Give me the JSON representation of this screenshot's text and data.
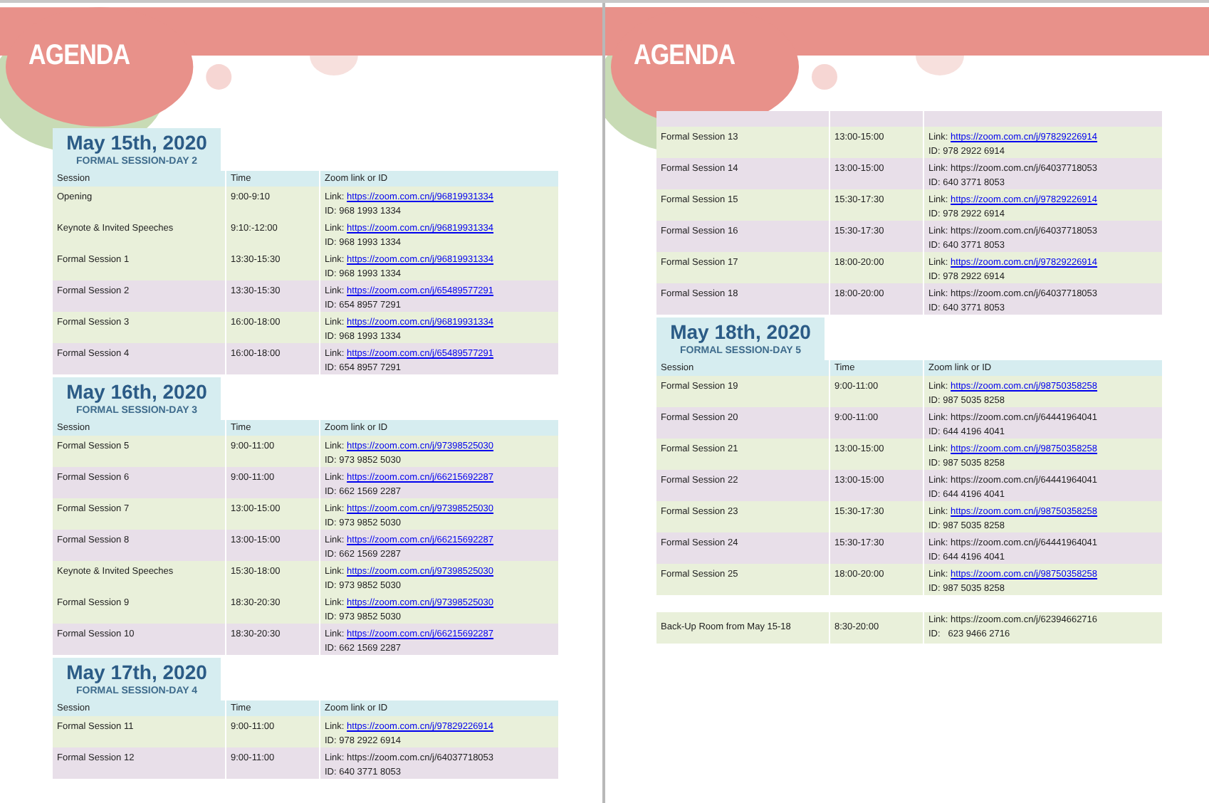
{
  "pages": [
    {
      "title": "AGENDA",
      "sections": [
        {
          "kind": "day",
          "date": "May 15th, 2020",
          "subtitle": "FORMAL SESSION-DAY 2",
          "columns": [
            "Session",
            "Time",
            "Zoom link or ID"
          ],
          "rows": [
            {
              "session": "Opening",
              "time": "9:00-9:10",
              "link_label": "Link:",
              "url": "https://zoom.com.cn/j/96819931334",
              "id": "ID: 968 1993 1334",
              "hyperlink": true,
              "color": "#e9f0da"
            },
            {
              "session": "Keynote & Invited Speeches",
              "time": "9:10:-12:00",
              "link_label": "Link:",
              "url": "https://zoom.com.cn/j/96819931334",
              "id": "ID: 968 1993 1334",
              "hyperlink": true,
              "color": "#e9f0da"
            },
            {
              "session": "Formal Session 1",
              "time": "13:30-15:30",
              "link_label": "Link:",
              "url": "https://zoom.com.cn/j/96819931334",
              "id": "ID: 968 1993 1334",
              "hyperlink": true,
              "color": "#e9f0da"
            },
            {
              "session": "Formal Session 2",
              "time": "13:30-15:30",
              "link_label": "Link:",
              "url": "https://zoom.com.cn/j/65489577291",
              "id": "ID: 654 8957 7291",
              "hyperlink": true,
              "color": "#e8dfe9"
            },
            {
              "session": "Formal Session 3",
              "time": "16:00-18:00",
              "link_label": "Link:",
              "url": "https://zoom.com.cn/j/96819931334",
              "id": "ID: 968 1993 1334",
              "hyperlink": true,
              "color": "#e9f0da"
            },
            {
              "session": "Formal Session 4",
              "time": "16:00-18:00",
              "link_label": "Link:",
              "url": "https://zoom.com.cn/j/65489577291",
              "id": "ID: 654 8957 7291",
              "hyperlink": true,
              "color": "#e8dfe9"
            }
          ]
        },
        {
          "kind": "day",
          "date": "May 16th, 2020",
          "subtitle": "FORMAL SESSION-DAY 3",
          "columns": [
            "Session",
            "Time",
            "Zoom link or ID"
          ],
          "rows": [
            {
              "session": "Formal Session 5",
              "time": "9:00-11:00",
              "link_label": "Link:",
              "url": "https://zoom.com.cn/j/97398525030",
              "id": "ID: 973 9852 5030",
              "hyperlink": true,
              "color": "#e9f0da"
            },
            {
              "session": "Formal Session 6",
              "time": "9:00-11:00",
              "link_label": "Link:",
              "url": "https://zoom.com.cn/j/66215692287",
              "id": "ID: 662 1569 2287",
              "hyperlink": true,
              "color": "#e8dfe9"
            },
            {
              "session": "Formal Session 7",
              "time": "13:00-15:00",
              "link_label": "Link:",
              "url": "https://zoom.com.cn/j/97398525030",
              "id": "ID: 973 9852 5030",
              "hyperlink": true,
              "color": "#e9f0da"
            },
            {
              "session": "Formal Session 8",
              "time": "13:00-15:00",
              "link_label": "Link:",
              "url": "https://zoom.com.cn/j/66215692287",
              "id": "ID: 662 1569 2287",
              "hyperlink": true,
              "color": "#e8dfe9"
            },
            {
              "session": "Keynote & Invited Speeches",
              "time": "15:30-18:00",
              "link_label": "Link:",
              "url": "https://zoom.com.cn/j/97398525030",
              "id": "ID: 973 9852 5030",
              "hyperlink": true,
              "color": "#e9f0da"
            },
            {
              "session": "Formal Session 9",
              "time": "18:30-20:30",
              "link_label": "Link:",
              "url": "https://zoom.com.cn/j/97398525030",
              "id": "ID: 973 9852 5030",
              "hyperlink": true,
              "color": "#e9f0da"
            },
            {
              "session": "Formal Session 10",
              "time": "18:30-20:30",
              "link_label": "Link:",
              "url": "https://zoom.com.cn/j/66215692287",
              "id": "ID: 662 1569 2287",
              "hyperlink": true,
              "color": "#e8dfe9"
            }
          ]
        },
        {
          "kind": "day",
          "date": "May 17th, 2020",
          "subtitle": "FORMAL SESSION-DAY 4",
          "columns": [
            "Session",
            "Time",
            "Zoom link or ID"
          ],
          "rows": [
            {
              "session": "Formal Session 11",
              "time": "9:00-11:00",
              "link_label": "Link:",
              "url": "https://zoom.com.cn/j/97829226914",
              "id": "ID: 978 2922 6914",
              "hyperlink": true,
              "color": "#e9f0da"
            },
            {
              "session": "Formal Session 12",
              "time": "9:00-11:00",
              "link_label": "Link:",
              "url": "https://zoom.com.cn/j/64037718053",
              "id": "ID: 640 3771 8053",
              "hyperlink": false,
              "color": "#e8dfe9"
            }
          ]
        }
      ]
    },
    {
      "title": "AGENDA",
      "sections": [
        {
          "kind": "continuation",
          "rows": [
            {
              "session": "Formal Session 13",
              "time": "13:00-15:00",
              "link_label": "Link:",
              "url": "https://zoom.com.cn/j/97829226914",
              "id": "ID: 978 2922 6914",
              "hyperlink": true,
              "color": "#e9f0da"
            },
            {
              "session": "Formal Session 14",
              "time": "13:00-15:00",
              "link_label": "Link:",
              "url": "https://zoom.com.cn/j/64037718053",
              "id": "ID: 640 3771 8053",
              "hyperlink": false,
              "color": "#e8dfe9"
            },
            {
              "session": "Formal Session 15",
              "time": "15:30-17:30",
              "link_label": "Link:",
              "url": "https://zoom.com.cn/j/97829226914",
              "id": "ID: 978 2922 6914",
              "hyperlink": true,
              "color": "#e9f0da"
            },
            {
              "session": "Formal Session 16",
              "time": "15:30-17:30",
              "link_label": "Link:",
              "url": "https://zoom.com.cn/j/64037718053",
              "id": "ID: 640 3771 8053",
              "hyperlink": false,
              "color": "#e8dfe9"
            },
            {
              "session": "Formal Session 17",
              "time": "18:00-20:00",
              "link_label": "Link:",
              "url": "https://zoom.com.cn/j/97829226914",
              "id": "ID: 978 2922 6914",
              "hyperlink": true,
              "color": "#e9f0da"
            },
            {
              "session": "Formal Session 18",
              "time": "18:00-20:00",
              "link_label": "Link:",
              "url": "https://zoom.com.cn/j/64037718053",
              "id": "ID: 640 3771 8053",
              "hyperlink": false,
              "color": "#e8dfe9"
            }
          ]
        },
        {
          "kind": "day",
          "date": "May 18th, 2020",
          "subtitle": "FORMAL SESSION-DAY 5",
          "columns": [
            "Session",
            "Time",
            "Zoom link or ID"
          ],
          "rows": [
            {
              "session": "Formal Session 19",
              "time": "9:00-11:00",
              "link_label": "Link:",
              "url": "https://zoom.com.cn/j/98750358258",
              "id": "ID: 987 5035 8258",
              "hyperlink": true,
              "color": "#e9f0da"
            },
            {
              "session": "Formal Session 20",
              "time": "9:00-11:00",
              "link_label": "Link:",
              "url": "https://zoom.com.cn/j/64441964041",
              "id": "ID: 644 4196 4041",
              "hyperlink": false,
              "color": "#e8dfe9"
            },
            {
              "session": "Formal Session 21",
              "time": "13:00-15:00",
              "link_label": "Link:",
              "url": "https://zoom.com.cn/j/98750358258",
              "id": "ID: 987 5035 8258",
              "hyperlink": true,
              "color": "#e9f0da"
            },
            {
              "session": "Formal Session 22",
              "time": "13:00-15:00",
              "link_label": "Link:",
              "url": "https://zoom.com.cn/j/64441964041",
              "id": "ID: 644 4196 4041",
              "hyperlink": false,
              "color": "#e8dfe9"
            },
            {
              "session": "Formal Session 23",
              "time": "15:30-17:30",
              "link_label": "Link:",
              "url": "https://zoom.com.cn/j/98750358258",
              "id": "ID: 987 5035 8258",
              "hyperlink": true,
              "color": "#e9f0da"
            },
            {
              "session": "Formal Session 24",
              "time": "15:30-17:30",
              "link_label": "Link:",
              "url": "https://zoom.com.cn/j/64441964041",
              "id": "ID: 644 4196 4041",
              "hyperlink": false,
              "color": "#e8dfe9"
            },
            {
              "session": "Formal Session 25",
              "time": "18:00-20:00",
              "link_label": "Link:",
              "url": "https://zoom.com.cn/j/98750358258",
              "id": "ID: 987 5035 8258",
              "hyperlink": true,
              "color": "#e9f0da"
            }
          ]
        },
        {
          "kind": "extra",
          "rows": [
            {
              "session": "Back-Up Room from May 15-18",
              "time": "8:30-20:00",
              "link_label": "Link:",
              "url": "https://zoom.com.cn/j/62394662716",
              "id": "ID:   623 9466 2716",
              "hyperlink": false,
              "color": "#e9f0da"
            }
          ]
        }
      ]
    }
  ]
}
